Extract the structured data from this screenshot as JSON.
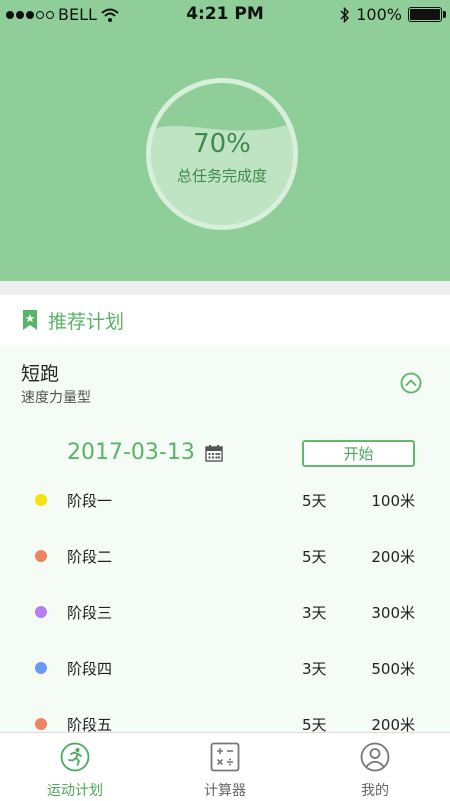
{
  "status_bar": {
    "carrier": "BELL",
    "time": "4:21 PM",
    "battery": "100%"
  },
  "progress": {
    "percent_label": "70%",
    "fill": 0.7,
    "caption": "总任务完成度"
  },
  "section": {
    "title": "推荐计划"
  },
  "plan": {
    "name": "短跑",
    "type": "速度力量型"
  },
  "schedule": {
    "date": "2017-03-13",
    "start_label": "开始",
    "stages": [
      {
        "name": "阶段一",
        "days": "5天",
        "distance": "100米",
        "color": "#f5e10f"
      },
      {
        "name": "阶段二",
        "days": "5天",
        "distance": "200米",
        "color": "#ef8362"
      },
      {
        "name": "阶段三",
        "days": "3天",
        "distance": "300米",
        "color": "#b77ef3"
      },
      {
        "name": "阶段四",
        "days": "3天",
        "distance": "500米",
        "color": "#6c98f3"
      },
      {
        "name": "阶段五",
        "days": "5天",
        "distance": "200米",
        "color": "#ef8362"
      }
    ]
  },
  "tabs": [
    {
      "label": "运动计划",
      "icon": "runner-icon",
      "active": true
    },
    {
      "label": "计算器",
      "icon": "calculator-icon",
      "active": false
    },
    {
      "label": "我的",
      "icon": "user-icon",
      "active": false
    }
  ],
  "colors": {
    "accent": "#58b466",
    "hero_bg": "#90ce99",
    "ring_fill": "#bfe4c4"
  }
}
